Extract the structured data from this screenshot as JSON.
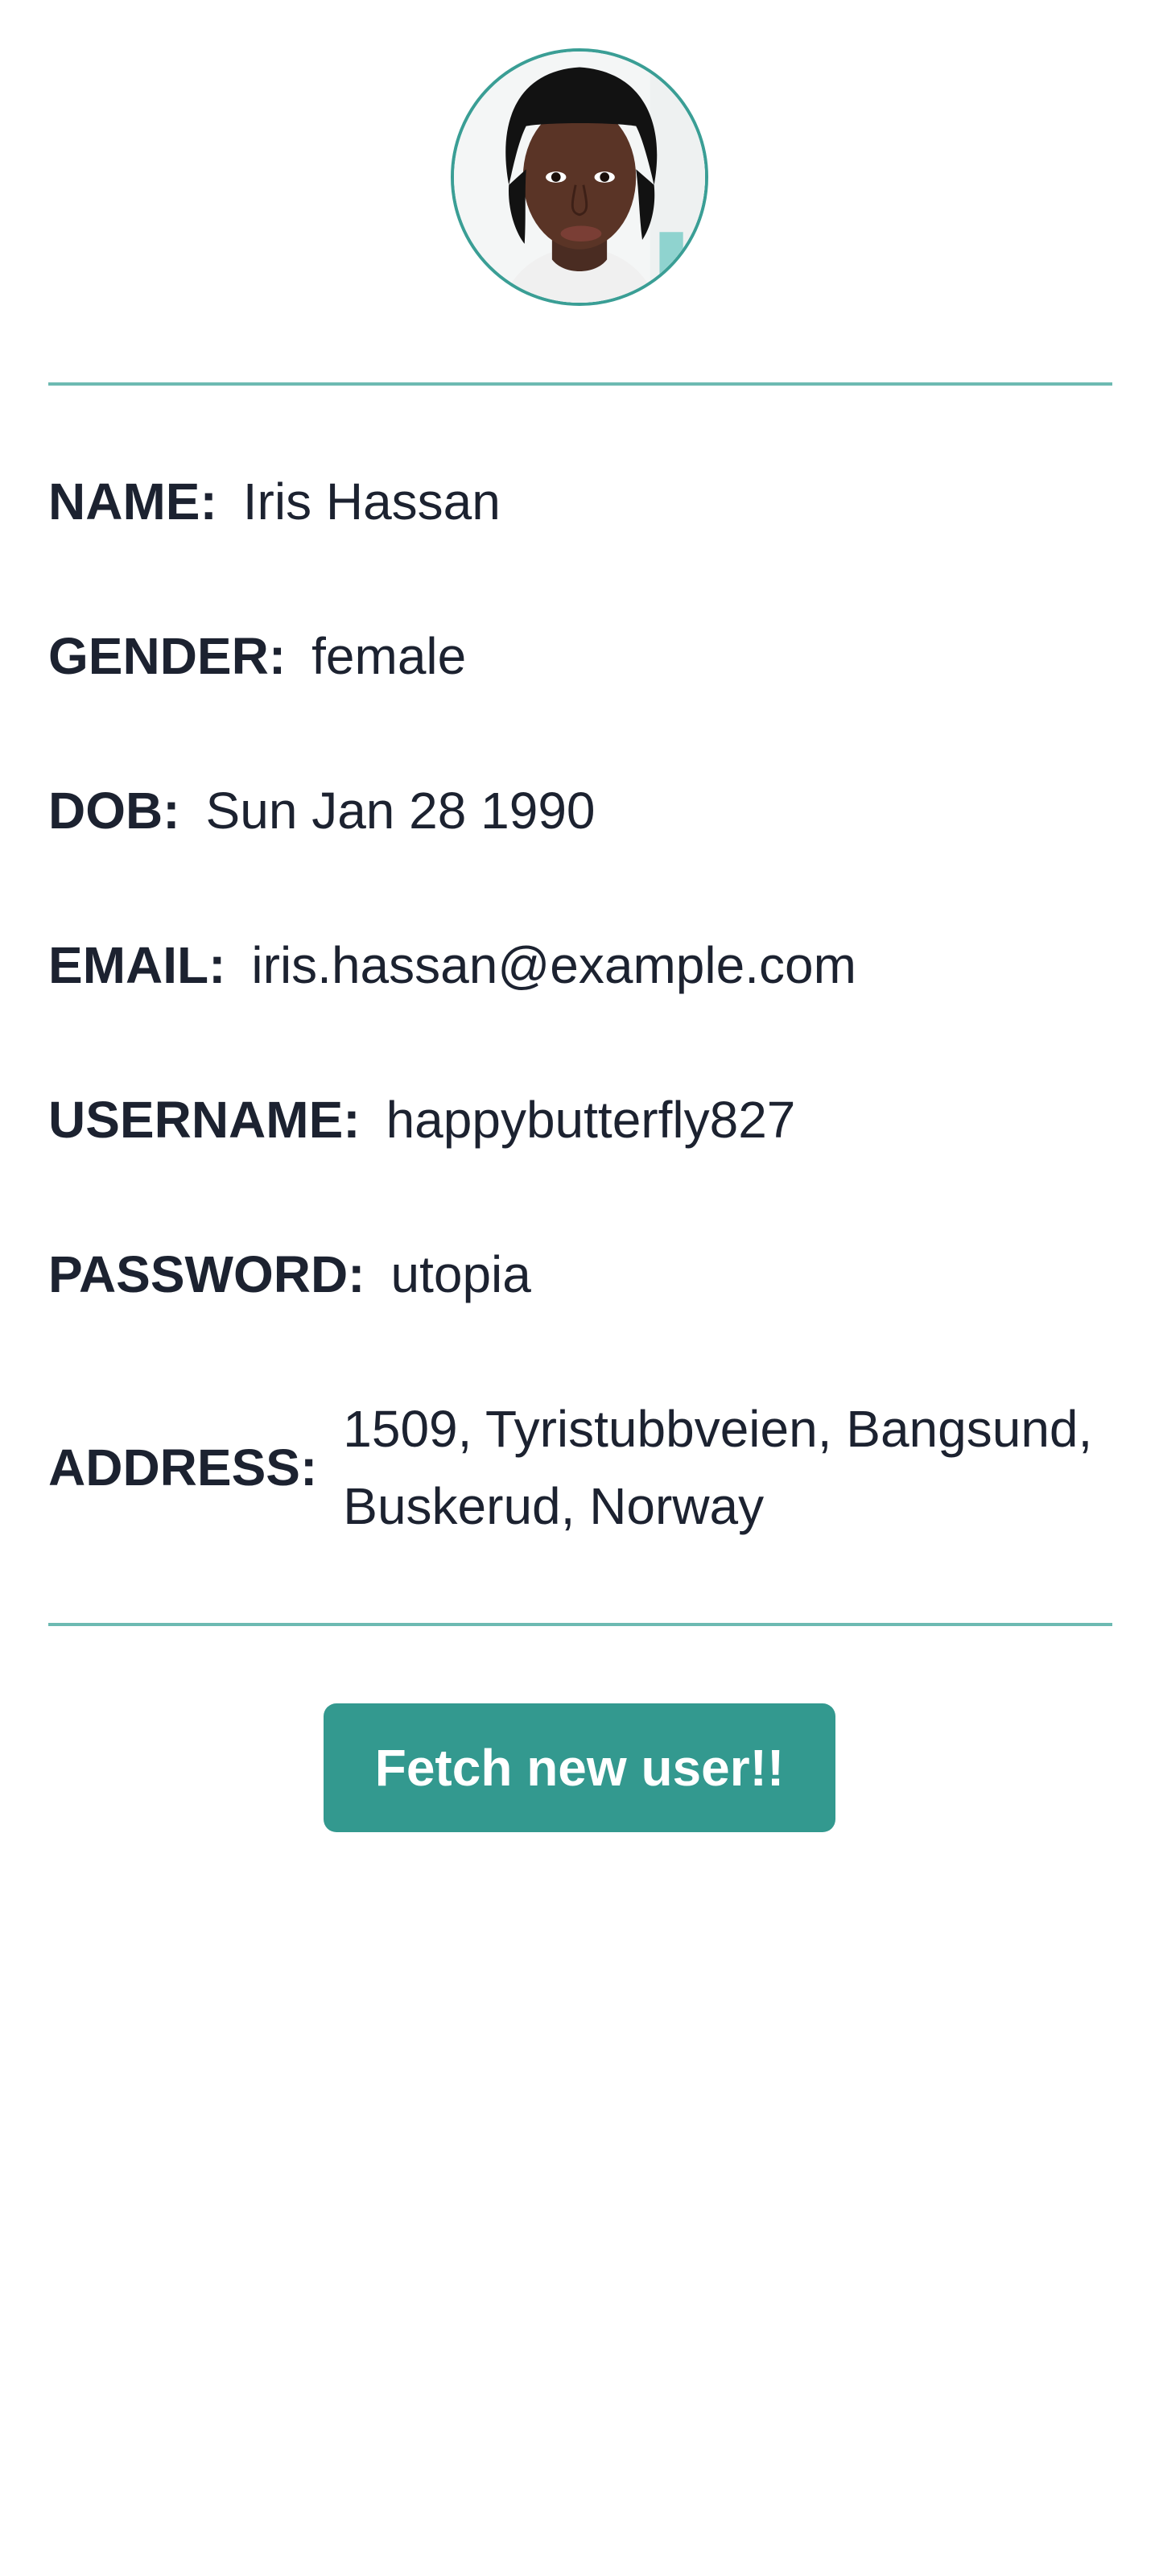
{
  "user": {
    "avatar_icon": "profile-photo",
    "fields": {
      "name": {
        "label": "NAME:",
        "value": "Iris Hassan"
      },
      "gender": {
        "label": "GENDER:",
        "value": "female"
      },
      "dob": {
        "label": "DOB:",
        "value": "Sun Jan 28 1990"
      },
      "email": {
        "label": "EMAIL:",
        "value": "iris.hassan@example.com"
      },
      "username": {
        "label": "USERNAME:",
        "value": "happybutterfly827"
      },
      "password": {
        "label": "PASSWORD:",
        "value": "utopia"
      },
      "address": {
        "label": "ADDRESS:",
        "value": "1509, Tyristubbveien, Bangsund, Buskerud, Norway"
      }
    }
  },
  "actions": {
    "fetch_label": "Fetch new user!!"
  },
  "colors": {
    "accent": "#33998f",
    "divider": "#6dbab2",
    "text": "#1c2230",
    "background": "#ffffff"
  }
}
